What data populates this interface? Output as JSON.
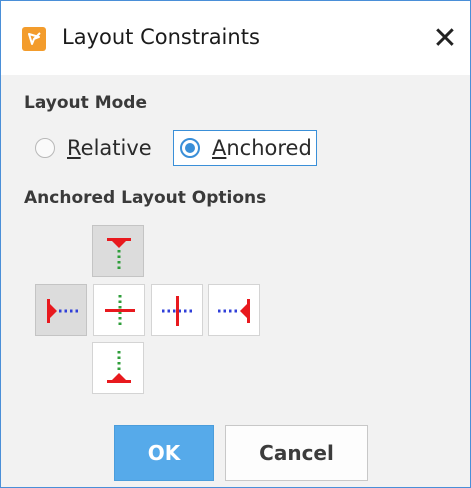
{
  "window": {
    "title": "Layout Constraints",
    "close_glyph": "✕",
    "app_icon": "pencil-ruler-icon",
    "accent_color": "#f39c2c"
  },
  "layout_mode": {
    "label": "Layout Mode",
    "options": [
      {
        "label_mnemonic": "R",
        "label_rest": "elative",
        "selected": false
      },
      {
        "label_mnemonic": "A",
        "label_rest": "nchored",
        "selected": true
      }
    ]
  },
  "anchored_options": {
    "label": "Anchored Layout Options",
    "buttons": [
      {
        "name": "anchor-top",
        "icon": "anchor-top-icon",
        "selected": true
      },
      {
        "name": "anchor-left",
        "icon": "anchor-left-icon",
        "selected": true
      },
      {
        "name": "anchor-center-vertical",
        "icon": "anchor-center-vertical-icon",
        "selected": false
      },
      {
        "name": "anchor-center-horizontal",
        "icon": "anchor-center-horizontal-icon",
        "selected": false
      },
      {
        "name": "anchor-right",
        "icon": "anchor-right-icon",
        "selected": false
      },
      {
        "name": "anchor-bottom",
        "icon": "anchor-bottom-icon",
        "selected": false
      }
    ]
  },
  "buttons": {
    "ok_label": "OK",
    "cancel_label": "Cancel"
  },
  "colors": {
    "selection_blue": "#3a8fd8",
    "ok_button": "#56aaea",
    "anchor_red": "#e8191e",
    "guide_green": "#2e9e3a",
    "guide_blue": "#2f3fd9"
  }
}
